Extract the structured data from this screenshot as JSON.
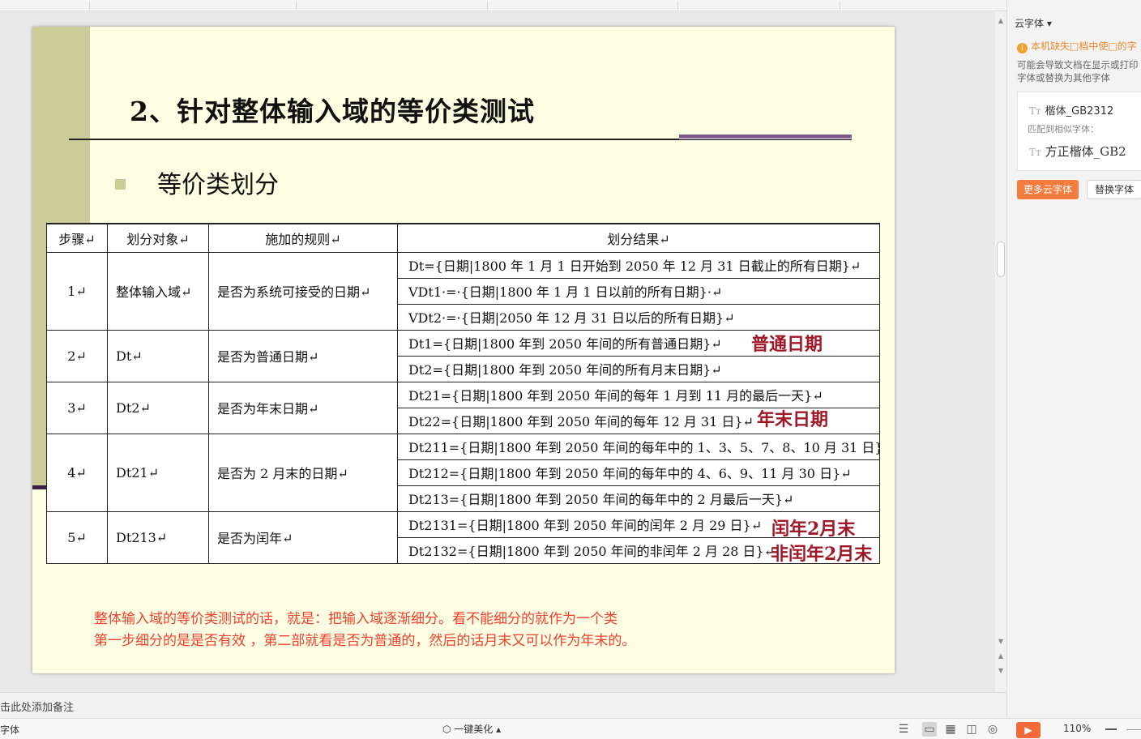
{
  "slide": {
    "title": "2、针对整体输入域的等价类测试",
    "bullet": "等价类划分",
    "table": {
      "headers": [
        "步骤↵",
        "划分对象↵",
        "施加的规则↵",
        "划分结果↵"
      ],
      "groups": [
        {
          "step": "1↵",
          "target": "整体输入域↵",
          "rule": "是否为系统可接受的日期↵",
          "results": [
            "Dt={日期|1800 年 1 月 1 日开始到 2050 年 12 月 31 日截止的所有日期}↵",
            "VDt1·=·{日期|1800 年 1 月 1 日以前的所有日期}·↵",
            "VDt2·=·{日期|2050 年 12 月 31 日以后的所有日期}↵"
          ]
        },
        {
          "step": "2↵",
          "target": "Dt↵",
          "rule": "是否为普通日期↵",
          "results": [
            "Dt1={日期|1800 年到 2050 年间的所有普通日期}↵",
            "Dt2={日期|1800 年到 2050 年间的所有月末日期}↵"
          ]
        },
        {
          "step": "3↵",
          "target": "Dt2↵",
          "rule": "是否为年末日期↵",
          "results": [
            "Dt21={日期|1800 年到 2050 年间的每年 1 月到 11 月的最后一天}↵",
            "Dt22={日期|1800 年到 2050 年间的每年 12 月 31 日}↵"
          ]
        },
        {
          "step": "4↵",
          "target": "Dt21↵",
          "rule": "是否为 2 月末的日期↵",
          "results": [
            "Dt211={日期|1800 年到 2050 年间的每年中的 1、3、5、7、8、10 月 31 日}↵",
            "Dt212={日期|1800 年到 2050 年间的每年中的 4、6、9、11 月 30 日}↵",
            "Dt213={日期|1800 年到 2050 年间的每年中的 2 月最后一天}↵"
          ]
        },
        {
          "step": "5↵",
          "target": "Dt213↵",
          "rule": "是否为闰年↵",
          "results": [
            "Dt2131={日期|1800 年到 2050 年间的闰年 2 月 29 日}↵",
            "Dt2132={日期|1800 年到 2050 年间的非闰年 2 月 28 日}↵"
          ]
        }
      ]
    },
    "annotations": {
      "normal_date": "普通日期",
      "year_end": "年末日期",
      "leap_feb_end": "闰年2月末",
      "nonleap_feb_end": "非闰年2月末"
    },
    "notes_text": [
      "整体输入域的等价类测试的话，就是：把输入域逐渐细分。看不能细分的就作为一个类",
      "第一步细分的是是否有效 ，第二部就看是否为普通的，然后的话月末又可以作为年末的。"
    ]
  },
  "notes_placeholder": "击此处添加备注",
  "status_bar": {
    "font_label": "字体",
    "beautify_label": "一键美化",
    "zoom": "110%"
  },
  "cloud_font_panel": {
    "title": "云字体",
    "warning": "本机缺失□档中使□的字",
    "description_lines": [
      "可能会导致文档在显示或打印",
      "字体或替换为其他字体"
    ],
    "missing_font": "楷体_GB2312",
    "matched_label": "匹配到相似字体：",
    "matched_font": "方正楷体_GB2",
    "more_button": "更多云字体",
    "replace_button": "替换字体"
  },
  "colors": {
    "slide_bg": "#fefee2",
    "accent_bar": "#cccc99",
    "annotation": "#a01828",
    "note_text": "#f04030",
    "orange_button": "#f37c3e"
  }
}
